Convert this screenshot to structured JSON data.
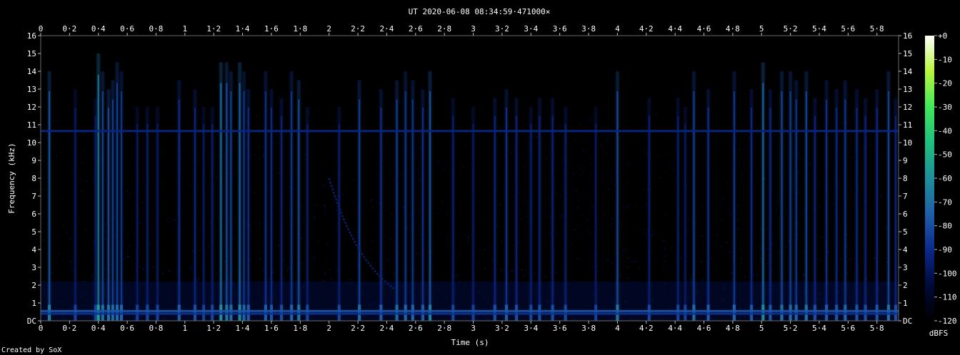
{
  "chart_data": {
    "type": "heatmap",
    "title": "UT 2020-06-08 08:34:59·471000×",
    "xlabel": "Time (s)",
    "ylabel": "Frequency (kHz)",
    "xlim": [
      0,
      5.95
    ],
    "ylim": [
      0,
      16
    ],
    "x_ticks": [
      "0",
      "0·2",
      "0·4",
      "0·6",
      "0·8",
      "1",
      "1·2",
      "1·4",
      "1·6",
      "1·8",
      "2",
      "2·2",
      "2·4",
      "2·6",
      "2·8",
      "3",
      "3·2",
      "3·4",
      "3·6",
      "3·8",
      "4",
      "4·2",
      "4·4",
      "4·6",
      "4·8",
      "5",
      "5·2",
      "5·4",
      "5·6",
      "5·8"
    ],
    "x_tick_values": [
      0,
      0.2,
      0.4,
      0.6,
      0.8,
      1.0,
      1.2,
      1.4,
      1.6,
      1.8,
      2.0,
      2.2,
      2.4,
      2.6,
      2.8,
      3.0,
      3.2,
      3.4,
      3.6,
      3.8,
      4.0,
      4.2,
      4.4,
      4.6,
      4.8,
      5.0,
      5.2,
      5.4,
      5.6,
      5.8
    ],
    "y_ticks": [
      "DC",
      "1",
      "2",
      "3",
      "4",
      "5",
      "6",
      "7",
      "8",
      "9",
      "10",
      "11",
      "12",
      "13",
      "14",
      "15",
      "16"
    ],
    "y_tick_values": [
      0,
      1,
      2,
      3,
      4,
      5,
      6,
      7,
      8,
      9,
      10,
      11,
      12,
      13,
      14,
      15,
      16
    ],
    "colorbar": {
      "label": "dBFS",
      "ticks": [
        "+0",
        "-10",
        "-20",
        "-30",
        "-40",
        "-50",
        "-60",
        "-70",
        "-80",
        "-90",
        "-100",
        "-110",
        "-120"
      ],
      "tick_values": [
        0,
        -10,
        -20,
        -30,
        -40,
        -50,
        -60,
        -70,
        -80,
        -90,
        -100,
        -110,
        -120
      ],
      "range": [
        -120,
        0
      ],
      "stops": [
        "#000000",
        "#000a3a",
        "#0b2a8c",
        "#1f5fa8",
        "#1e8f9a",
        "#1fbf7f",
        "#3fe85a",
        "#b8f53a",
        "#ffffff"
      ]
    },
    "background_color": "#000000",
    "noise_floor_dbfs": -108,
    "horizontal_lines": [
      {
        "freq_khz": 10.65,
        "dbfs": -92
      },
      {
        "freq_khz": 0.55,
        "dbfs": -78
      },
      {
        "freq_khz": 0.4,
        "dbfs": -88
      }
    ],
    "impulses": [
      {
        "t": 0.06,
        "top_khz": 14.0,
        "dbfs": -78
      },
      {
        "t": 0.24,
        "top_khz": 13.0,
        "dbfs": -96
      },
      {
        "t": 0.38,
        "top_khz": 12.5,
        "dbfs": -96
      },
      {
        "t": 0.4,
        "top_khz": 15.0,
        "dbfs": -68
      },
      {
        "t": 0.43,
        "top_khz": 14.0,
        "dbfs": -82
      },
      {
        "t": 0.47,
        "top_khz": 13.0,
        "dbfs": -80
      },
      {
        "t": 0.5,
        "top_khz": 13.5,
        "dbfs": -84
      },
      {
        "t": 0.53,
        "top_khz": 14.5,
        "dbfs": -84
      },
      {
        "t": 0.56,
        "top_khz": 14.0,
        "dbfs": -86
      },
      {
        "t": 0.67,
        "top_khz": 12.0,
        "dbfs": -96
      },
      {
        "t": 0.74,
        "top_khz": 12.0,
        "dbfs": -94
      },
      {
        "t": 0.81,
        "top_khz": 12.0,
        "dbfs": -96
      },
      {
        "t": 0.96,
        "top_khz": 13.5,
        "dbfs": -88
      },
      {
        "t": 1.07,
        "top_khz": 13.0,
        "dbfs": -92
      },
      {
        "t": 1.13,
        "top_khz": 12.0,
        "dbfs": -96
      },
      {
        "t": 1.19,
        "top_khz": 12.0,
        "dbfs": -94
      },
      {
        "t": 1.25,
        "top_khz": 14.5,
        "dbfs": -72
      },
      {
        "t": 1.29,
        "top_khz": 14.5,
        "dbfs": -80
      },
      {
        "t": 1.32,
        "top_khz": 14.0,
        "dbfs": -84
      },
      {
        "t": 1.38,
        "top_khz": 14.5,
        "dbfs": -74
      },
      {
        "t": 1.41,
        "top_khz": 14.0,
        "dbfs": -86
      },
      {
        "t": 1.44,
        "top_khz": 13.0,
        "dbfs": -88
      },
      {
        "t": 1.56,
        "top_khz": 14.0,
        "dbfs": -88
      },
      {
        "t": 1.6,
        "top_khz": 13.0,
        "dbfs": -90
      },
      {
        "t": 1.67,
        "top_khz": 12.5,
        "dbfs": -92
      },
      {
        "t": 1.74,
        "top_khz": 14.0,
        "dbfs": -86
      },
      {
        "t": 1.79,
        "top_khz": 13.5,
        "dbfs": -80
      },
      {
        "t": 1.85,
        "top_khz": 12.0,
        "dbfs": -94
      },
      {
        "t": 2.07,
        "top_khz": 12.0,
        "dbfs": -94
      },
      {
        "t": 2.21,
        "top_khz": 13.5,
        "dbfs": -84
      },
      {
        "t": 2.36,
        "top_khz": 13.0,
        "dbfs": -88
      },
      {
        "t": 2.47,
        "top_khz": 13.5,
        "dbfs": -84
      },
      {
        "t": 2.53,
        "top_khz": 14.0,
        "dbfs": -86
      },
      {
        "t": 2.58,
        "top_khz": 13.5,
        "dbfs": -86
      },
      {
        "t": 2.65,
        "top_khz": 13.0,
        "dbfs": -88
      },
      {
        "t": 2.7,
        "top_khz": 14.0,
        "dbfs": -78
      },
      {
        "t": 2.86,
        "top_khz": 12.5,
        "dbfs": -94
      },
      {
        "t": 3.0,
        "top_khz": 12.0,
        "dbfs": -96
      },
      {
        "t": 3.15,
        "top_khz": 12.5,
        "dbfs": -92
      },
      {
        "t": 3.23,
        "top_khz": 13.0,
        "dbfs": -88
      },
      {
        "t": 3.3,
        "top_khz": 12.5,
        "dbfs": -92
      },
      {
        "t": 3.4,
        "top_khz": 12.0,
        "dbfs": -94
      },
      {
        "t": 3.46,
        "top_khz": 12.5,
        "dbfs": -92
      },
      {
        "t": 3.55,
        "top_khz": 12.5,
        "dbfs": -92
      },
      {
        "t": 3.64,
        "top_khz": 12.0,
        "dbfs": -94
      },
      {
        "t": 3.85,
        "top_khz": 12.0,
        "dbfs": -96
      },
      {
        "t": 4.0,
        "top_khz": 14.0,
        "dbfs": -80
      },
      {
        "t": 4.22,
        "top_khz": 12.5,
        "dbfs": -94
      },
      {
        "t": 4.42,
        "top_khz": 12.5,
        "dbfs": -94
      },
      {
        "t": 4.47,
        "top_khz": 12.0,
        "dbfs": -96
      },
      {
        "t": 4.53,
        "top_khz": 14.0,
        "dbfs": -84
      },
      {
        "t": 4.63,
        "top_khz": 13.0,
        "dbfs": -88
      },
      {
        "t": 4.81,
        "top_khz": 14.0,
        "dbfs": -86
      },
      {
        "t": 4.93,
        "top_khz": 13.0,
        "dbfs": -90
      },
      {
        "t": 5.01,
        "top_khz": 14.5,
        "dbfs": -74
      },
      {
        "t": 5.06,
        "top_khz": 13.0,
        "dbfs": -90
      },
      {
        "t": 5.14,
        "top_khz": 14.0,
        "dbfs": -82
      },
      {
        "t": 5.2,
        "top_khz": 14.0,
        "dbfs": -84
      },
      {
        "t": 5.24,
        "top_khz": 13.5,
        "dbfs": -86
      },
      {
        "t": 5.31,
        "top_khz": 14.0,
        "dbfs": -82
      },
      {
        "t": 5.37,
        "top_khz": 12.5,
        "dbfs": -92
      },
      {
        "t": 5.45,
        "top_khz": 13.5,
        "dbfs": -88
      },
      {
        "t": 5.52,
        "top_khz": 13.0,
        "dbfs": -90
      },
      {
        "t": 5.58,
        "top_khz": 13.5,
        "dbfs": -86
      },
      {
        "t": 5.66,
        "top_khz": 13.0,
        "dbfs": -90
      },
      {
        "t": 5.72,
        "top_khz": 12.5,
        "dbfs": -92
      },
      {
        "t": 5.8,
        "top_khz": 13.0,
        "dbfs": -90
      },
      {
        "t": 5.88,
        "top_khz": 14.0,
        "dbfs": -82
      },
      {
        "t": 5.93,
        "top_khz": 12.5,
        "dbfs": -92
      }
    ],
    "sweeps": [
      {
        "t_start": 2.0,
        "f_start_khz": 8.0,
        "t_end": 2.45,
        "f_end_khz": 1.8,
        "dbfs": -94
      }
    ]
  },
  "footer": {
    "credit": "Created by SoX"
  }
}
